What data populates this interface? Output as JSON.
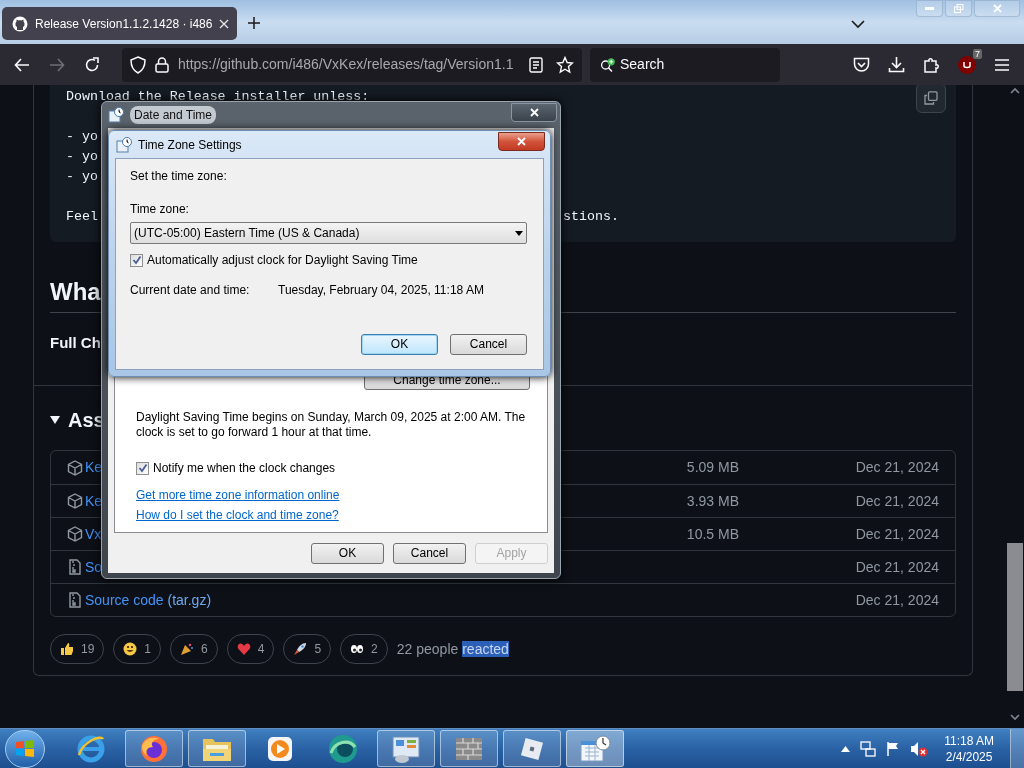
{
  "browser": {
    "tab": {
      "title": "Release Version1.1.2.1428 · i486",
      "selected": true
    },
    "url": "https://github.com/i486/VxKex/releases/tag/Version1.1",
    "search": {
      "placeholder": "Search"
    },
    "extension_badge": "7"
  },
  "release": {
    "code_block": {
      "paragraphs": [
        {
          "lines": [
            "Download the Release installer unless:"
          ]
        },
        {
          "lines": [
            "- yo",
            "- yo",
            "- yo"
          ]
        },
        {
          "lines": [
            "Feel"
          ]
        }
      ],
      "tail": "stions."
    },
    "heading": "Wha",
    "changelog_label": "Full Ch",
    "assets_title": "Ass",
    "assets": [
      {
        "kind": "package",
        "name": "Ke",
        "size": "5.09 MB",
        "date": "Dec 21, 2024"
      },
      {
        "kind": "package",
        "name": "Ke",
        "size": "3.93 MB",
        "date": "Dec 21, 2024"
      },
      {
        "kind": "package",
        "name": "Vx",
        "size": "10.5 MB",
        "date": "Dec 21, 2024"
      },
      {
        "kind": "archive",
        "name": "So",
        "date": "Dec 21, 2024"
      },
      {
        "kind": "archive",
        "name": "Source code",
        "suffix": "(tar.gz)",
        "date": "Dec 21, 2024"
      }
    ],
    "reactions": [
      {
        "kind": "thumbs-up",
        "count": "19"
      },
      {
        "kind": "smile",
        "count": "1"
      },
      {
        "kind": "party",
        "count": "6"
      },
      {
        "kind": "heart",
        "count": "4"
      },
      {
        "kind": "rocket",
        "count": "5"
      },
      {
        "kind": "eyes",
        "count": "2"
      }
    ],
    "reaction_summary": {
      "text": "22 people",
      "selected_text": "reacted"
    }
  },
  "date_time_window": {
    "title": "Date and Time",
    "change_button": "Change time zone...",
    "dst_note": "Daylight Saving Time begins on Sunday, March 09, 2025 at 2:00 AM. The clock is set to go forward 1 hour at that time.",
    "notify": {
      "label": "Notify me when the clock changes",
      "checked": true
    },
    "links": [
      "Get more time zone information online",
      "How do I set the clock and time zone?"
    ],
    "buttons": [
      {
        "label": "OK",
        "default": false,
        "disabled": false
      },
      {
        "label": "Cancel",
        "default": false,
        "disabled": false
      },
      {
        "label": "Apply",
        "default": false,
        "disabled": true
      }
    ]
  },
  "time_zone_dialog": {
    "title": "Time Zone Settings",
    "intro": "Set the time zone:",
    "zone_label": "Time zone:",
    "zone_value": "(UTC-05:00) Eastern Time (US & Canada)",
    "dst": {
      "label": "Automatically adjust clock for Daylight Saving Time",
      "checked": true
    },
    "current_label": "Current date and time:",
    "current_value": "Tuesday, February 04, 2025, 11:18 AM",
    "buttons": [
      {
        "label": "OK",
        "default": true,
        "disabled": false
      },
      {
        "label": "Cancel",
        "default": false,
        "disabled": false
      }
    ]
  },
  "taskbar": {
    "apps": [
      {
        "kind": "ie",
        "running": false,
        "selected": false
      },
      {
        "kind": "firefox",
        "running": true,
        "selected": false
      },
      {
        "kind": "explorer",
        "running": true,
        "selected": false
      },
      {
        "kind": "media",
        "running": false,
        "selected": false
      },
      {
        "kind": "teal",
        "running": false,
        "selected": false
      },
      {
        "kind": "control-panel",
        "running": true,
        "selected": false
      },
      {
        "kind": "firewall",
        "running": true,
        "selected": false
      },
      {
        "kind": "roblox",
        "running": true,
        "selected": false
      },
      {
        "kind": "datetime",
        "running": true,
        "selected": true
      }
    ],
    "clock": {
      "time": "11:18 AM",
      "date": "2/4/2025"
    }
  }
}
